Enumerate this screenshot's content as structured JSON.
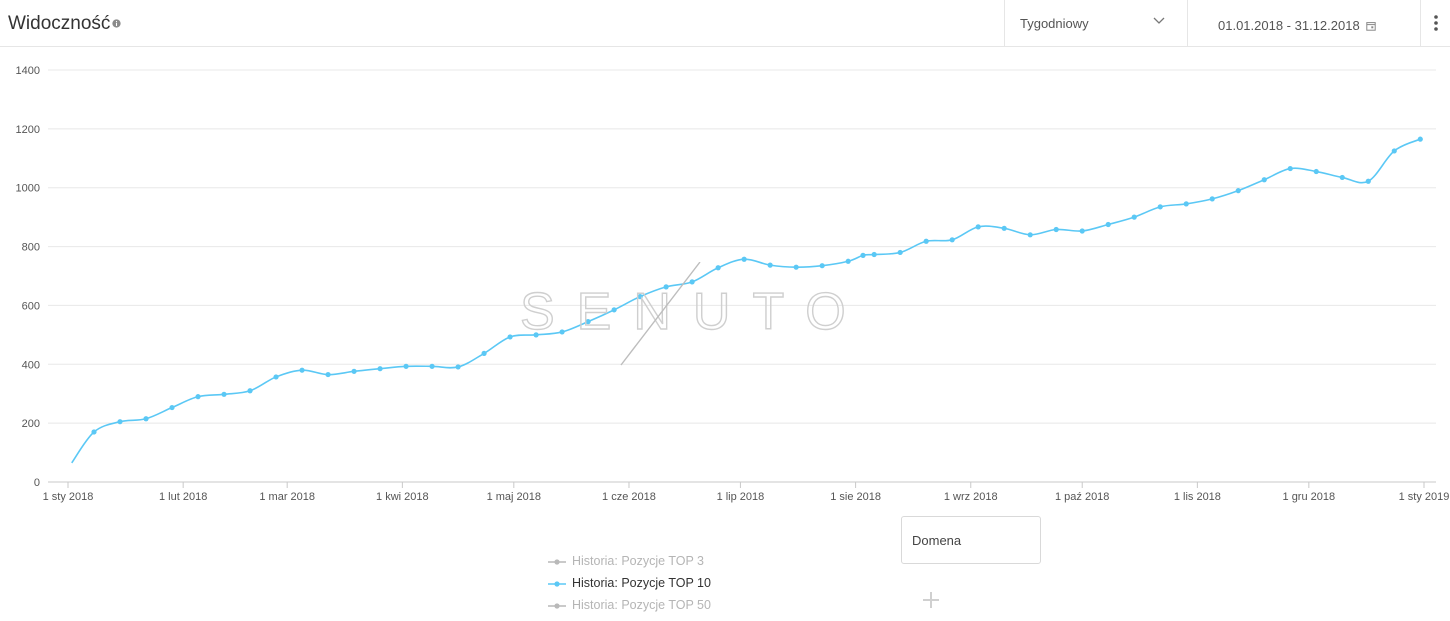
{
  "header": {
    "title": "Widoczność",
    "period": "Tygodniowy",
    "date_range": "01.01.2018 - 31.12.2018"
  },
  "watermark": "SENUTO",
  "legend": [
    {
      "label": "Historia: Pozycje TOP 3",
      "active": false,
      "color": "#b9b9b9"
    },
    {
      "label": "Historia: Pozycje TOP 10",
      "active": true,
      "color": "#5bc8f5"
    },
    {
      "label": "Historia: Pozycje TOP 50",
      "active": false,
      "color": "#b9b9b9"
    }
  ],
  "domain_box": {
    "label": "Domena"
  },
  "chart_data": {
    "type": "line",
    "title": "",
    "xlabel": "",
    "ylabel": "",
    "ylim": [
      0,
      1400
    ],
    "yticks": [
      0,
      200,
      400,
      600,
      800,
      1000,
      1200,
      1400
    ],
    "xlim": [
      "2018-01-01",
      "2019-01-01"
    ],
    "xticks": [
      {
        "date": "2018-01-01",
        "label": "1 sty 2018"
      },
      {
        "date": "2018-02-01",
        "label": "1 lut 2018"
      },
      {
        "date": "2018-03-01",
        "label": "1 mar 2018"
      },
      {
        "date": "2018-04-01",
        "label": "1 kwi 2018"
      },
      {
        "date": "2018-05-01",
        "label": "1 maj 2018"
      },
      {
        "date": "2018-06-01",
        "label": "1 cze 2018"
      },
      {
        "date": "2018-07-01",
        "label": "1 lip 2018"
      },
      {
        "date": "2018-08-01",
        "label": "1 sie 2018"
      },
      {
        "date": "2018-09-01",
        "label": "1 wrz 2018"
      },
      {
        "date": "2018-10-01",
        "label": "1 paź 2018"
      },
      {
        "date": "2018-11-01",
        "label": "1 lis 2018"
      },
      {
        "date": "2018-12-01",
        "label": "1 gru 2018"
      },
      {
        "date": "2019-01-01",
        "label": "1 sty 2019"
      }
    ],
    "grid": true,
    "legend_position": "bottom",
    "series": [
      {
        "name": "Historia: Pozycje TOP 10",
        "color": "#5bc8f5",
        "points": [
          {
            "date": "2018-01-02",
            "y": 65
          },
          {
            "date": "2018-01-08",
            "y": 170
          },
          {
            "date": "2018-01-15",
            "y": 205
          },
          {
            "date": "2018-01-22",
            "y": 215
          },
          {
            "date": "2018-01-29",
            "y": 253
          },
          {
            "date": "2018-02-05",
            "y": 290
          },
          {
            "date": "2018-02-12",
            "y": 298
          },
          {
            "date": "2018-02-19",
            "y": 310
          },
          {
            "date": "2018-02-26",
            "y": 357
          },
          {
            "date": "2018-03-05",
            "y": 380
          },
          {
            "date": "2018-03-12",
            "y": 365
          },
          {
            "date": "2018-03-19",
            "y": 376
          },
          {
            "date": "2018-03-26",
            "y": 385
          },
          {
            "date": "2018-04-02",
            "y": 393
          },
          {
            "date": "2018-04-09",
            "y": 393
          },
          {
            "date": "2018-04-16",
            "y": 391
          },
          {
            "date": "2018-04-23",
            "y": 437
          },
          {
            "date": "2018-04-30",
            "y": 493
          },
          {
            "date": "2018-05-07",
            "y": 500
          },
          {
            "date": "2018-05-14",
            "y": 510
          },
          {
            "date": "2018-05-21",
            "y": 545
          },
          {
            "date": "2018-05-28",
            "y": 585
          },
          {
            "date": "2018-06-04",
            "y": 630
          },
          {
            "date": "2018-06-11",
            "y": 663
          },
          {
            "date": "2018-06-18",
            "y": 680
          },
          {
            "date": "2018-06-25",
            "y": 728
          },
          {
            "date": "2018-07-02",
            "y": 757
          },
          {
            "date": "2018-07-09",
            "y": 737
          },
          {
            "date": "2018-07-16",
            "y": 730
          },
          {
            "date": "2018-07-23",
            "y": 735
          },
          {
            "date": "2018-07-30",
            "y": 750
          },
          {
            "date": "2018-08-03",
            "y": 770
          },
          {
            "date": "2018-08-06",
            "y": 773
          },
          {
            "date": "2018-08-13",
            "y": 780
          },
          {
            "date": "2018-08-20",
            "y": 818
          },
          {
            "date": "2018-08-27",
            "y": 823
          },
          {
            "date": "2018-09-03",
            "y": 867
          },
          {
            "date": "2018-09-10",
            "y": 862
          },
          {
            "date": "2018-09-17",
            "y": 840
          },
          {
            "date": "2018-09-24",
            "y": 858
          },
          {
            "date": "2018-10-01",
            "y": 853
          },
          {
            "date": "2018-10-08",
            "y": 875
          },
          {
            "date": "2018-10-15",
            "y": 900
          },
          {
            "date": "2018-10-22",
            "y": 935
          },
          {
            "date": "2018-10-29",
            "y": 945
          },
          {
            "date": "2018-11-05",
            "y": 962
          },
          {
            "date": "2018-11-12",
            "y": 990
          },
          {
            "date": "2018-11-19",
            "y": 1027
          },
          {
            "date": "2018-11-26",
            "y": 1065
          },
          {
            "date": "2018-12-03",
            "y": 1055
          },
          {
            "date": "2018-12-10",
            "y": 1035
          },
          {
            "date": "2018-12-17",
            "y": 1022
          },
          {
            "date": "2018-12-24",
            "y": 1125
          },
          {
            "date": "2018-12-31",
            "y": 1165
          }
        ]
      }
    ]
  }
}
